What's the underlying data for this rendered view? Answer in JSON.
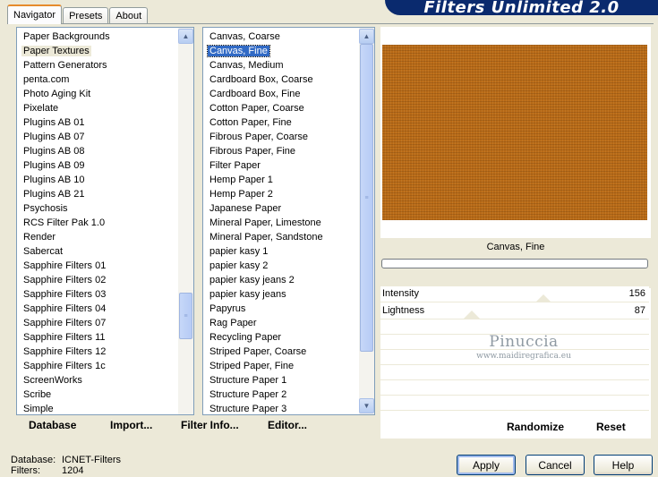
{
  "banner": {
    "title": "Filters Unlimited 2.0"
  },
  "tabs": [
    "Navigator",
    "Presets",
    "About"
  ],
  "categories": {
    "items": [
      "Paper Backgrounds",
      "Paper Textures",
      "Pattern Generators",
      "penta.com",
      "Photo Aging Kit",
      "Pixelate",
      "Plugins AB 01",
      "Plugins AB 07",
      "Plugins AB 08",
      "Plugins AB 09",
      "Plugins AB 10",
      "Plugins AB 21",
      "Psychosis",
      "RCS Filter Pak 1.0",
      "Render",
      "Sabercat",
      "Sapphire Filters 01",
      "Sapphire Filters 02",
      "Sapphire Filters 03",
      "Sapphire Filters 04",
      "Sapphire Filters 07",
      "Sapphire Filters 11",
      "Sapphire Filters 12",
      "Sapphire Filters 1c",
      "ScreenWorks",
      "Scribe",
      "Simple"
    ],
    "highlighted_index": 1
  },
  "filters": {
    "items": [
      "Canvas, Coarse",
      "Canvas, Fine",
      "Canvas, Medium",
      "Cardboard Box, Coarse",
      "Cardboard Box, Fine",
      "Cotton Paper, Coarse",
      "Cotton Paper, Fine",
      "Fibrous Paper, Coarse",
      "Fibrous Paper, Fine",
      "Filter Paper",
      "Hemp Paper 1",
      "Hemp Paper 2",
      "Japanese Paper",
      "Mineral Paper, Limestone",
      "Mineral Paper, Sandstone",
      "papier kasy 1",
      "papier kasy 2",
      "papier kasy jeans 2",
      "papier kasy jeans",
      "Papyrus",
      "Rag Paper",
      "Recycling Paper",
      "Striped Paper, Coarse",
      "Striped Paper, Fine",
      "Structure Paper 1",
      "Structure Paper 2",
      "Structure Paper 3"
    ],
    "selected_index": 1
  },
  "list_buttons": {
    "database": "Database",
    "import": "Import...",
    "filter_info": "Filter Info...",
    "editor": "Editor..."
  },
  "preview": {
    "caption": "Canvas, Fine",
    "texture_color": "#b86a17",
    "watermark_line1": "Pinuccia",
    "watermark_line2": "www.maidiregrafica.eu"
  },
  "params": [
    {
      "label": "Intensity",
      "value": "156"
    },
    {
      "label": "Lightness",
      "value": "87"
    }
  ],
  "preview_buttons": {
    "randomize": "Randomize",
    "reset": "Reset"
  },
  "footer": {
    "database_label": "Database:",
    "database_value": "ICNET-Filters",
    "filters_label": "Filters:",
    "filters_value": "1204"
  },
  "dialog_buttons": {
    "apply": "Apply",
    "cancel": "Cancel",
    "help": "Help"
  },
  "colors": {
    "accent": "#316ac5",
    "banner": "#0a2a6e",
    "dialog_bg": "#ece9d8"
  }
}
